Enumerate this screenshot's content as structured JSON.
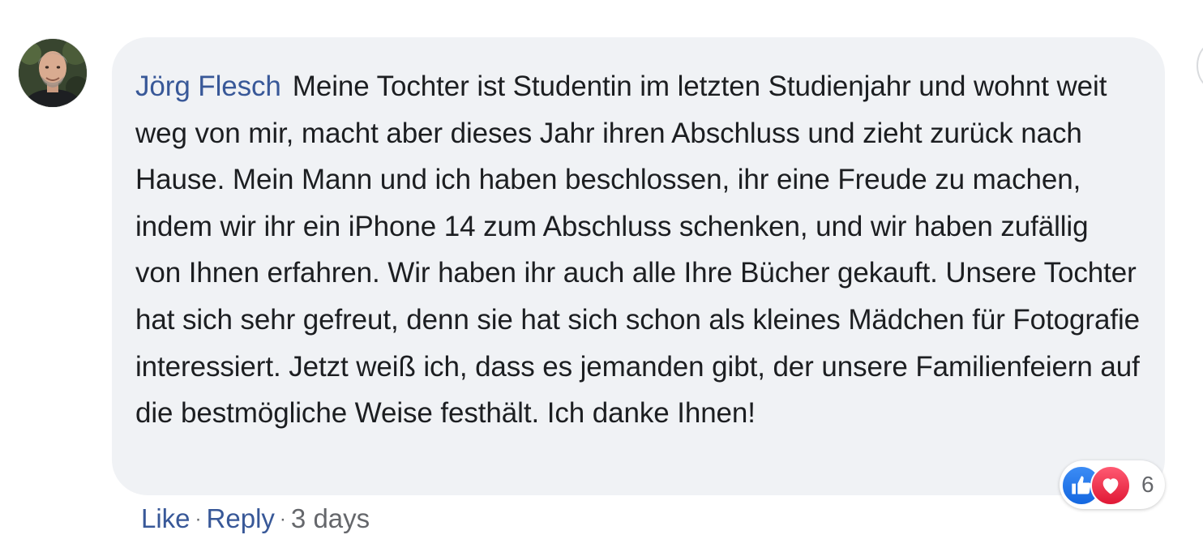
{
  "comment": {
    "author": "Jörg Flesch",
    "text": "Meine Tochter ist Studentin im letzten Studienjahr und wohnt weit weg von mir, macht aber dieses Jahr ihren Abschluss und zieht zurück nach Hause. Mein Mann und ich haben beschlossen, ihr eine Freude zu machen, indem wir ihr ein iPhone 14 zum Abschluss schenken, und wir haben zufällig von Ihnen erfahren. Wir haben ihr auch alle Ihre Bücher gekauft. Unsere Tochter hat sich sehr gefreut, denn sie hat sich schon als kleines Mädchen für Fotografie interessiert. Jetzt weiß ich, dass es jemanden gibt, der unsere Familienfeiern auf die bestmögliche Weise festhält. Ich danke Ihnen!",
    "reactions": {
      "icons": [
        "like-icon",
        "love-icon"
      ],
      "count": "6"
    },
    "actions": {
      "like_label": "Like",
      "reply_label": "Reply",
      "separator": "·",
      "timestamp": "3 days"
    }
  },
  "colors": {
    "author_link": "#385898",
    "bubble_bg": "#f0f2f5",
    "text": "#1c1e21",
    "meta": "#65676b",
    "like_blue": "#1877f2",
    "love_red": "#f02849"
  }
}
